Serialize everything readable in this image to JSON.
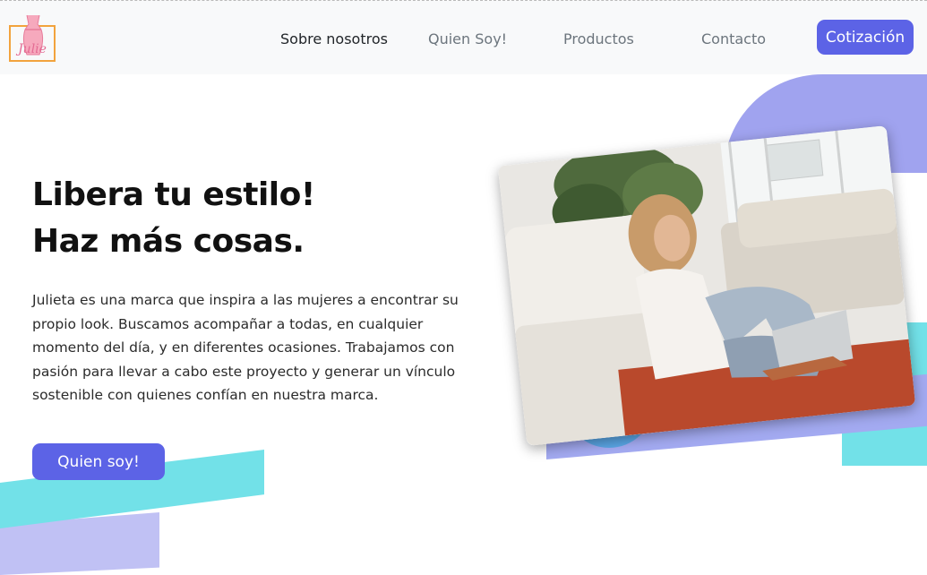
{
  "nav": {
    "logo_text": "Julie",
    "links": [
      "Sobre nosotros",
      "Quien Soy!",
      "Productos",
      "Contacto"
    ],
    "cta_label": "Cotización"
  },
  "hero": {
    "headline_line1": "Libera tu estilo!",
    "headline_line2": "Haz más cosas.",
    "description": "Julieta es una marca que inspira a las mujeres a encontrar su propio look. Buscamos acompañar a todas, en cualquier momento del día, y en diferentes ocasiones. Trabajamos con pasión para llevar a cabo este proyecto y generar un vínculo sostenible con quienes confían en nuestra marca.",
    "button_label": "Quien soy!"
  },
  "colors": {
    "accent": "#5c63e6",
    "lavender": "#a0a3ef",
    "cyan": "#72e1e8",
    "nav_bg": "#f8f9fa"
  }
}
